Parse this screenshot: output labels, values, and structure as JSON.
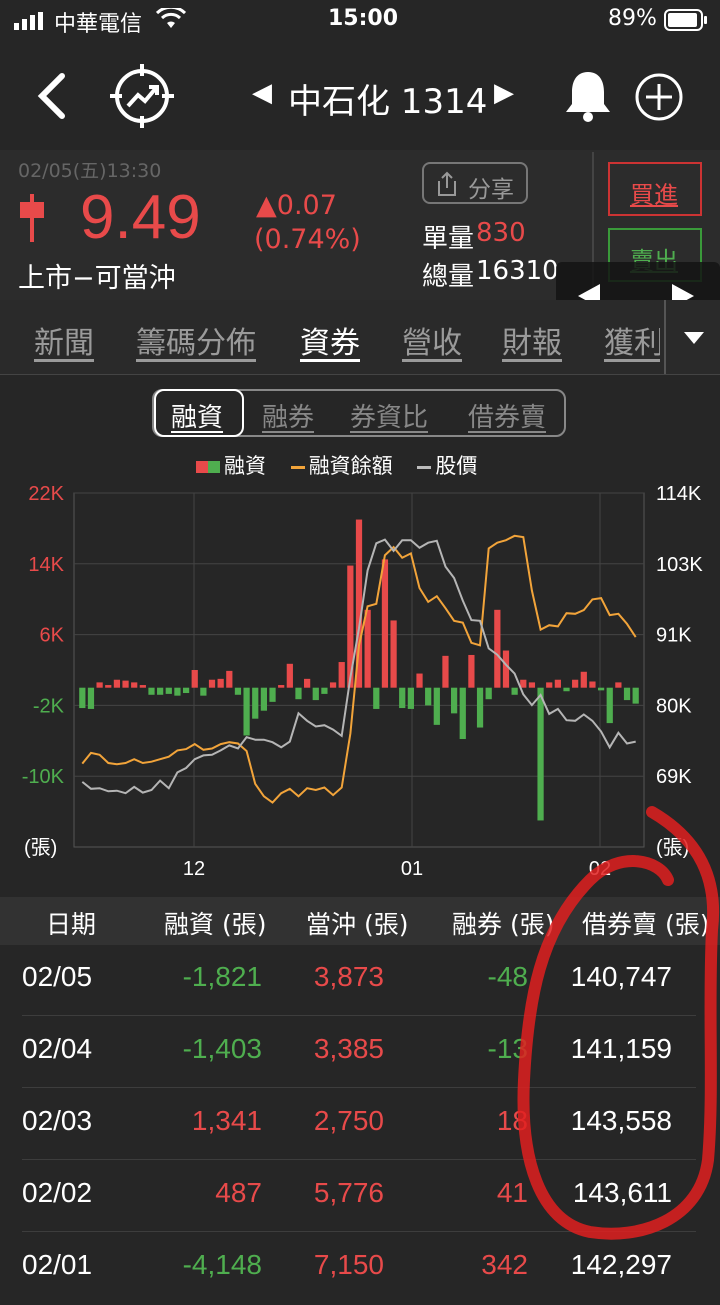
{
  "status": {
    "carrier": "中華電信",
    "time": "15:00",
    "battery": "89%"
  },
  "nav": {
    "title": "中石化 1314",
    "prev_arrow": "◀",
    "next_arrow": "▶"
  },
  "quote": {
    "datetime": "02/05(五)13:30",
    "price": "9.49",
    "change": "▲0.07",
    "change_pct": "(0.74%)",
    "market": "上市−可當沖",
    "share_label": "分享",
    "unit_volume_label": "單量",
    "unit_volume": "830",
    "total_volume_label": "總量",
    "total_volume": "16310",
    "buy_label": "買進",
    "sell_label": "賣出",
    "colors": {
      "up": "#e84a4a",
      "down": "#4fae4f"
    }
  },
  "tabs": [
    "新聞",
    "籌碼分佈",
    "資券",
    "營收",
    "財報",
    "獲利"
  ],
  "active_tab": "資券",
  "segments": [
    "融資",
    "融券",
    "券資比",
    "借券賣"
  ],
  "active_segment": "融資",
  "chart_data": {
    "type": "bar",
    "legend": [
      "融資",
      "融資餘額",
      "股價"
    ],
    "left_axis_ticks": [
      "22K",
      "14K",
      "6K",
      "-2K",
      "-10K"
    ],
    "left_axis_values": [
      22000,
      14000,
      6000,
      -2000,
      -10000
    ],
    "left_unit": "(張)",
    "right_axis_ticks": [
      "114K",
      "103K",
      "91K",
      "80K",
      "69K"
    ],
    "right_unit": "(張)",
    "x_ticks": [
      "12",
      "01",
      "02"
    ],
    "ylim": [
      -18000,
      22000
    ],
    "series": [
      {
        "name": "融資",
        "values": [
          -2300,
          -2400,
          600,
          300,
          900,
          800,
          600,
          300,
          -800,
          -800,
          -700,
          -900,
          -600,
          2000,
          -900,
          900,
          1000,
          1900,
          -800,
          -5400,
          -3500,
          -2600,
          -1600,
          300,
          2700,
          -1300,
          1000,
          -1400,
          -700,
          600,
          2900,
          13800,
          19000,
          8800,
          -2400,
          14500,
          7600,
          -2300,
          -2400,
          1600,
          -2000,
          -4200,
          3600,
          -2900,
          -5800,
          3700,
          -4500,
          -1300,
          8800,
          4200,
          -800,
          900,
          600,
          -15000,
          600,
          900,
          -400,
          900,
          1800,
          700,
          -300,
          -4000,
          600,
          -1400,
          -1800
        ]
      },
      {
        "name": "融資餘額",
        "values": [
          71000,
          72700,
          72400,
          71100,
          70900,
          71100,
          71700,
          71100,
          71300,
          71700,
          72100,
          73100,
          73300,
          74100,
          73200,
          73400,
          74100,
          74400,
          74200,
          73000,
          67800,
          65800,
          64800,
          66300,
          67000,
          65800,
          67100,
          66800,
          67200,
          66000,
          67200,
          75800,
          89800,
          96000,
          96400,
          104100,
          105400,
          103700,
          104400,
          98900,
          96700,
          97600,
          95700,
          93700,
          93400,
          90200,
          89800,
          105200,
          106100,
          106500,
          107200,
          107000,
          98500,
          92300,
          93000,
          92800,
          94900,
          94800,
          95400,
          97100,
          97300,
          94600,
          94800,
          93200,
          91100
        ]
      },
      {
        "name": "股價",
        "values": [
          68100,
          67000,
          67100,
          66600,
          66700,
          66300,
          67300,
          66400,
          66800,
          68300,
          67100,
          69600,
          70300,
          71700,
          72300,
          72400,
          73100,
          73900,
          73400,
          75200,
          74800,
          74800,
          74400,
          73600,
          74500,
          79000,
          77800,
          76900,
          77100,
          76400,
          75400,
          84700,
          92500,
          101700,
          106000,
          106600,
          104800,
          106500,
          106500,
          105300,
          106100,
          106400,
          102300,
          100500,
          96900,
          93800,
          93700,
          89300,
          88300,
          86700,
          85300,
          82000,
          80300,
          81900,
          78900,
          79700,
          77900,
          77800,
          78800,
          77800,
          76100,
          73600,
          75900,
          74200,
          74500
        ]
      }
    ]
  },
  "table": {
    "headers": [
      "日期",
      "融資 (張)",
      "當沖 (張)",
      "融券 (張)",
      "借券賣 (張)"
    ],
    "rows": [
      {
        "date": "02/05",
        "margin": "-1,821",
        "daytrade": "3,873",
        "short": "-48",
        "sbl": "140,747"
      },
      {
        "date": "02/04",
        "margin": "-1,403",
        "daytrade": "3,385",
        "short": "-13",
        "sbl": "141,159"
      },
      {
        "date": "02/03",
        "margin": "1,341",
        "daytrade": "2,750",
        "short": "18",
        "sbl": "143,558"
      },
      {
        "date": "02/02",
        "margin": "487",
        "daytrade": "5,776",
        "short": "41",
        "sbl": "143,611"
      },
      {
        "date": "02/01",
        "margin": "-4,148",
        "daytrade": "7,150",
        "short": "342",
        "sbl": "142,297"
      }
    ]
  },
  "icons": {
    "back": "back-chevron-icon",
    "chart_badge": "trend-chart-icon",
    "bell": "bell-icon",
    "plus": "plus-circle-icon",
    "share": "share-icon"
  }
}
